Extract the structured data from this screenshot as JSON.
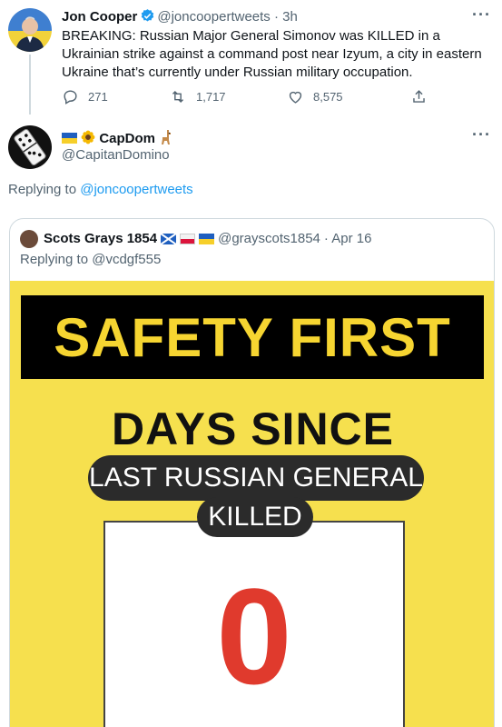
{
  "tweet": {
    "author_name": "Jon Cooper",
    "handle": "@joncoopertweets",
    "time": "· 3h",
    "text": "BREAKING: Russian Major General Simonov was KILLED in a Ukrainian strike against a command post near Izyum, a city in eastern Ukraine that’s currently under Russian military occupation.",
    "replies": "271",
    "retweets": "1,717",
    "likes": "8,575"
  },
  "reply": {
    "author_name": "CapDom",
    "handle": "@CapitanDomino",
    "replying_prefix": "Replying to",
    "replying_to": "@joncoopertweets"
  },
  "quoted": {
    "author_name": "Scots Grays 1854",
    "handle": "@grayscots1854",
    "date": "· Apr 16",
    "replying_to": "Replying to @vcdgf555",
    "sign": {
      "banner": "SAFETY FIRST",
      "days_since": "DAYS SINCE",
      "line1": "LAST RUSSIAN GENERAL",
      "line2": "KILLED",
      "count": "0"
    }
  },
  "colors": {
    "accent": "#1d9bf0",
    "sign_yellow": "#f6e04e",
    "banner_text": "#f6d531",
    "counter_red": "#e03a2d"
  },
  "icons": [
    "verified-badge-icon",
    "more-icon",
    "reply-icon",
    "retweet-icon",
    "like-icon",
    "share-icon"
  ]
}
